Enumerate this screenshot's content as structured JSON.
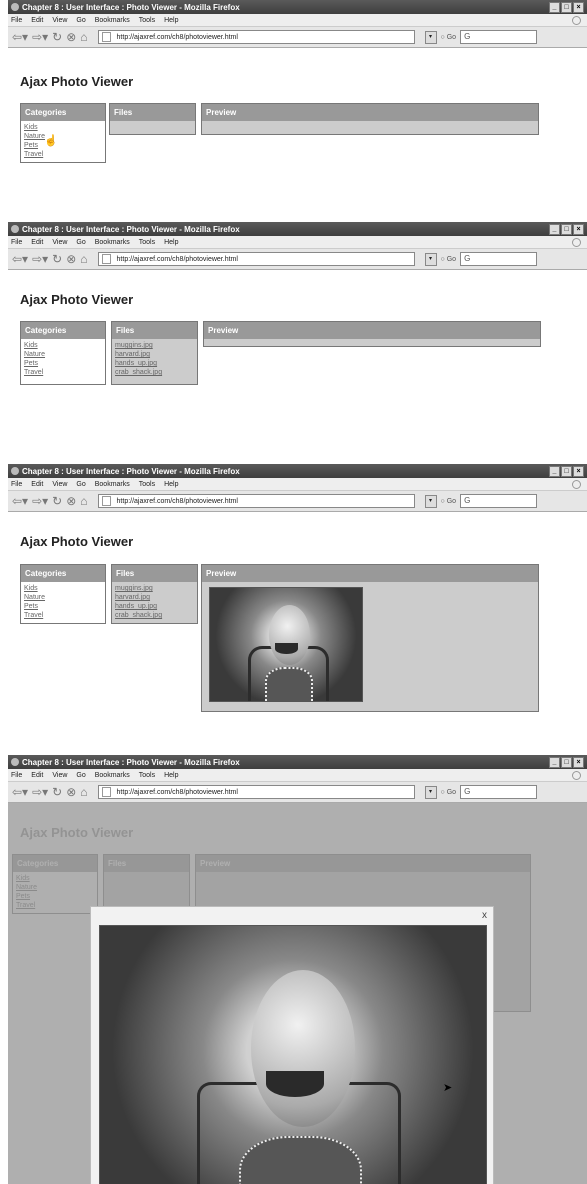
{
  "browser": {
    "title": "Chapter 8 : User Interface : Photo Viewer - Mozilla Firefox",
    "menu": [
      "File",
      "Edit",
      "View",
      "Go",
      "Bookmarks",
      "Tools",
      "Help"
    ],
    "url": "http://ajaxref.com/ch8/photoviewer.html",
    "go_label": "Go",
    "window_controls": [
      "_",
      "□",
      "×"
    ]
  },
  "app": {
    "title": "Ajax Photo Viewer",
    "categories_header": "Categories",
    "files_header": "Files",
    "preview_header": "Preview",
    "categories": [
      "Kids",
      "Nature",
      "Pets",
      "Travel"
    ],
    "files": [
      "muggins.jpg",
      "harvard.jpg",
      "hands_up.jpg",
      "crab_shack.jpg"
    ]
  },
  "lightbox": {
    "close_label": "x"
  },
  "icons": {
    "back": "back-arrow-icon",
    "forward": "forward-arrow-icon",
    "reload": "reload-icon",
    "stop": "stop-icon",
    "home": "home-icon",
    "search": "search-icon",
    "cursor": "mouse-pointer-icon"
  }
}
